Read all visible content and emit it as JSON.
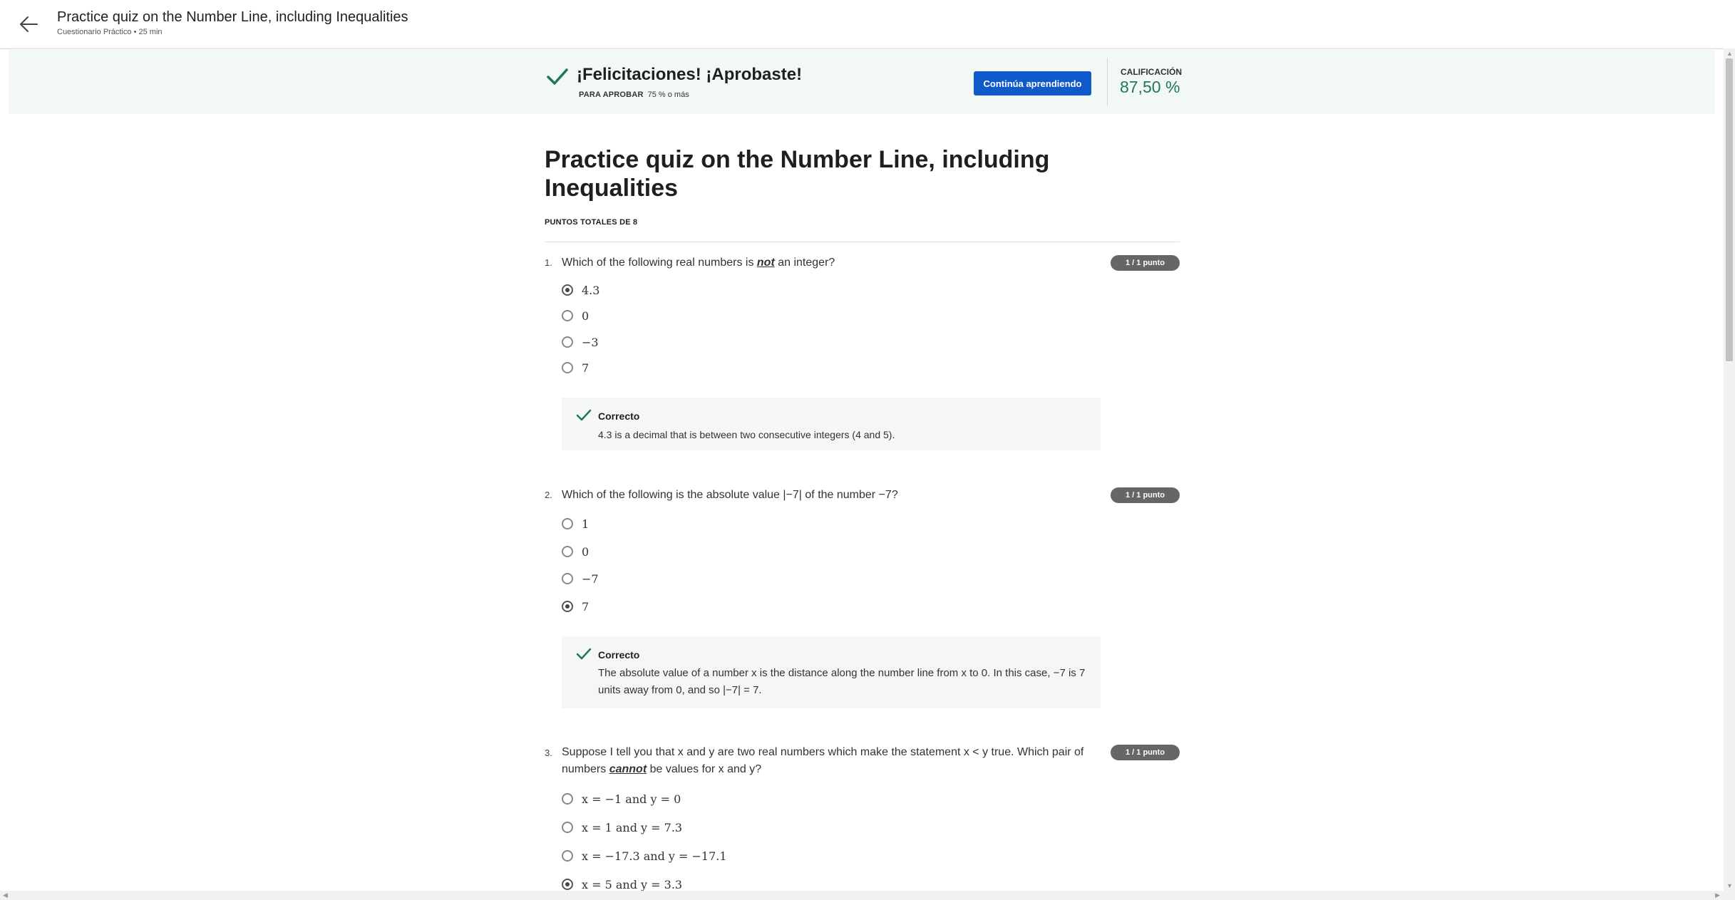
{
  "header": {
    "title": "Practice quiz on the Number Line, including Inequalities",
    "subtitle": "Cuestionario Práctico • 25 min"
  },
  "banner": {
    "message": "¡Felicitaciones! ¡Aprobaste!",
    "pass_label": "PARA APROBAR",
    "pass_value": "75 % o más",
    "continue_label": "Continúa aprendiendo",
    "grade_label": "CALIFICACIÓN",
    "grade_value": "87,50 %",
    "accent_color": "#1f7a54",
    "button_color": "#0f59c8"
  },
  "quiz": {
    "title": "Practice quiz on the Number Line, including Inequalities",
    "points_total": "PUNTOS TOTALES DE 8"
  },
  "questions": [
    {
      "number": "1.",
      "text_before": "Which of the following real numbers is ",
      "emphasis": "not",
      "text_after": " an integer?",
      "points": "1 / 1 punto",
      "options": [
        "4.3",
        "0",
        "−3",
        "7"
      ],
      "selected_index": 0,
      "feedback": {
        "title": "Correcto",
        "text": "4.3 is a decimal that is between two consecutive integers (4 and 5)."
      }
    },
    {
      "number": "2.",
      "text": "Which of the following is the absolute value |−7| of the number −7?",
      "points": "1 / 1 punto",
      "options": [
        "1",
        "0",
        "−7",
        "7"
      ],
      "selected_index": 3,
      "feedback": {
        "title": "Correcto",
        "text": "The absolute value of a number x is the distance along the number line from x to 0. In this case, −7 is 7 units away from 0, and so |−7| = 7."
      }
    },
    {
      "number": "3.",
      "text_before": "Suppose I tell you that x and y are two real numbers which make the statement x < y true. Which pair of numbers ",
      "emphasis": "cannot",
      "text_after": " be values for x and y?",
      "points": "1 / 1 punto",
      "options": [
        "x = −1 and y = 0",
        "x = 1 and y = 7.3",
        "x = −17.3 and y = −17.1",
        "x = 5 and y = 3.3"
      ],
      "selected_index": 3
    }
  ]
}
